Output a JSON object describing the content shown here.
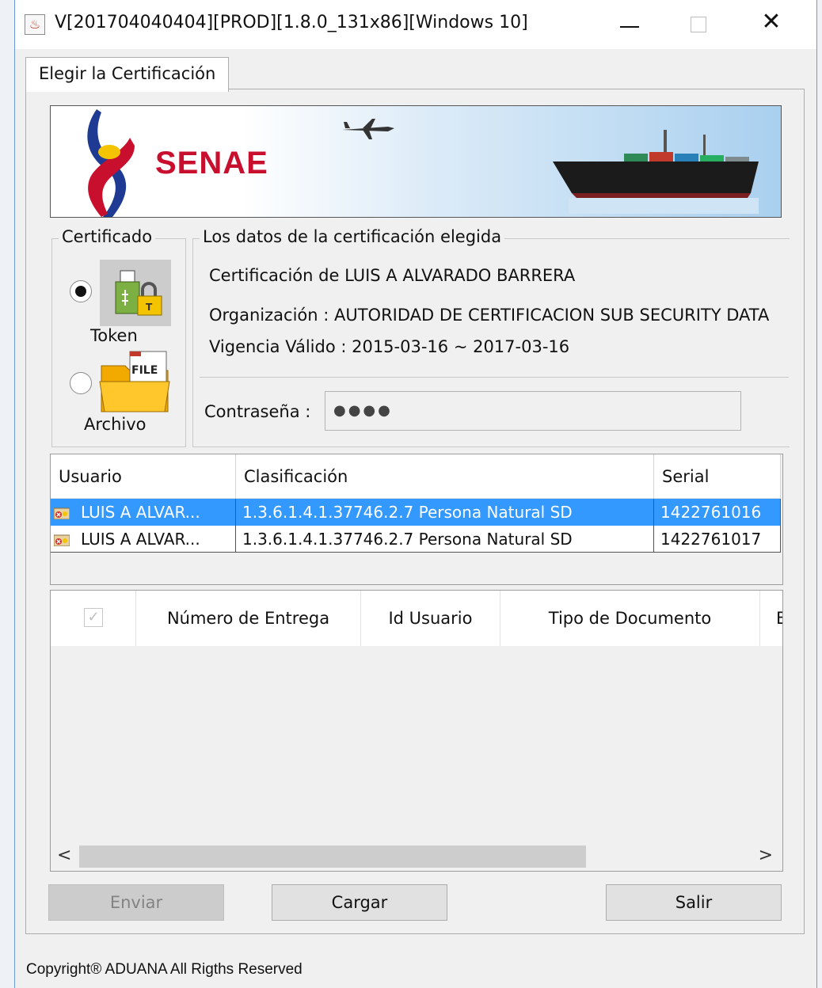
{
  "window": {
    "title": "V[201704040404][PROD][1.8.0_131x86][Windows 10]",
    "minimize_label": "—",
    "close_label": "✕"
  },
  "tab": {
    "label": "Elegir la Certificación"
  },
  "banner": {
    "logo_text": "SENAE"
  },
  "certificado_group": {
    "legend": "Certificado",
    "options": [
      {
        "label": "Token",
        "checked": true,
        "icon": "usb-token-lock-icon"
      },
      {
        "label": "Archivo",
        "checked": false,
        "icon": "file-folder-icon",
        "icon_text": "FILE"
      }
    ]
  },
  "data_group": {
    "legend": "Los datos de la certificación elegida",
    "certificacion": "Certificación de LUIS A ALVARADO BARRERA",
    "organizacion": "Organización : AUTORIDAD DE CERTIFICACION SUB SECURITY DATA",
    "vigencia": "Vigencia Válido : 2015-03-16 ~ 2017-03-16",
    "password_label": "Contraseña :",
    "password_value": "●●●●"
  },
  "cert_table": {
    "columns": [
      "Usuario",
      "Clasificación",
      "Serial"
    ],
    "rows": [
      {
        "usuario": "LUIS A ALVAR...",
        "clasificacion": "1.3.6.1.4.1.37746.2.7 Persona Natural SD",
        "serial": "1422761016",
        "selected": true
      },
      {
        "usuario": "LUIS A ALVAR...",
        "clasificacion": "1.3.6.1.4.1.37746.2.7 Persona Natural SD",
        "serial": "1422761017",
        "selected": false
      }
    ]
  },
  "entrega_table": {
    "check_glyph": "✓",
    "columns": [
      "Número de Entrega",
      "Id Usuario",
      "Tipo de Documento",
      "E"
    ],
    "scroll_left": "<",
    "scroll_right": ">"
  },
  "buttons": {
    "enviar": "Enviar",
    "cargar": "Cargar",
    "salir": "Salir"
  },
  "footer": {
    "copyright": "Copyright® ADUANA All Rigths Reserved"
  },
  "colors": {
    "selection": "#3399ff",
    "senae_red": "#c8102e",
    "window_border": "#6b9bd2"
  }
}
